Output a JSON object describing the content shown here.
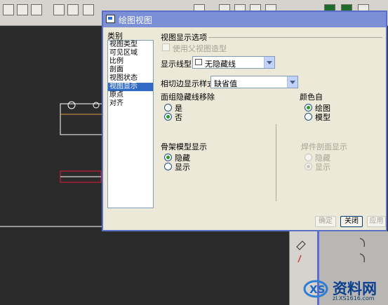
{
  "dialog": {
    "title": "绘图视图",
    "category_label": "类别",
    "categories": [
      "视图类型",
      "可见区域",
      "比例",
      "剖面",
      "视图状态",
      "视图显示",
      "原点",
      "对齐"
    ],
    "selected_category": "视图显示",
    "section_title": "视图显示选项",
    "use_parent_style": "使用父视图造型",
    "display_style_label": "显示线型",
    "display_style_value": "无隐藏线",
    "tangent_label": "相切边显示样式",
    "tangent_value": "缺省值",
    "hidden_removal_label": "面组隐藏线移除",
    "hidden_yes": "是",
    "hidden_no": "否",
    "color_from_label": "颜色自",
    "color_drawing": "绘图",
    "color_model": "模型",
    "skeleton_label": "骨架模型显示",
    "skeleton_hide": "隐藏",
    "skeleton_show": "显示",
    "weld_label": "焊件剖面显示",
    "weld_hide": "隐藏",
    "weld_show": "显示",
    "btn_ok": "确定",
    "btn_close": "关闭",
    "btn_apply": "应用"
  },
  "watermark": {
    "text": "资料网",
    "url": "zl.XS1616.com"
  },
  "colors": {
    "title_bar": "#7b8fd6",
    "selection": "#316ac5",
    "canvas": "#2b2b2b",
    "sketch_line": "#ffffff",
    "highlight_rect": "#e0193a"
  }
}
